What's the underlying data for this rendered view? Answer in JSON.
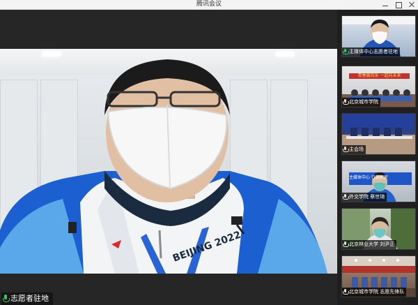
{
  "window": {
    "title": "腾讯会议"
  },
  "main_video": {
    "speaker_label": "志愿者驻地",
    "jacket_text": "BEIJING 2022",
    "icon": "mic-icon"
  },
  "participants": [
    {
      "label": "主媒体中心志愿者驻地",
      "mic": "active"
    },
    {
      "label": "北京城市学院",
      "mic": "muted",
      "banner": "青春展风采 一起向未来"
    },
    {
      "label": "主会场",
      "mic": "muted"
    },
    {
      "label": "外交学院 蔡世琦",
      "mic": "muted",
      "screen_text": "主媒体中心 行指挥室"
    },
    {
      "label": "北京林业大学 刘尹正",
      "mic": "muted"
    },
    {
      "label": "北京城市学院 志愿先锋队",
      "mic": "muted"
    }
  ],
  "colors": {
    "mic_active": "#3bc46b",
    "sidebar_bg": "#1f1f1f",
    "jacket_blue": "#1b5fd1"
  }
}
